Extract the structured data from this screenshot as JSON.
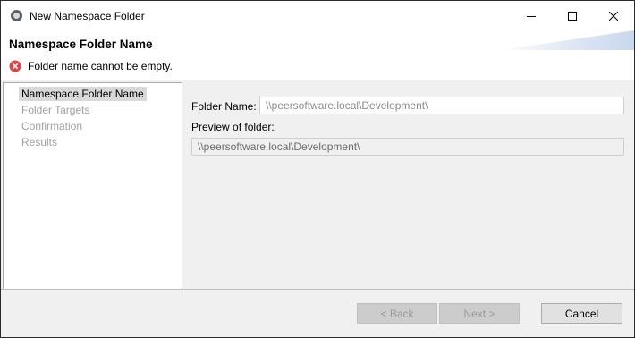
{
  "window": {
    "title": "New Namespace Folder",
    "icon": "app-icon",
    "controls": [
      "minimize-icon",
      "maximize-icon",
      "close-icon"
    ]
  },
  "header": {
    "title": "Namespace Folder Name",
    "error_icon": "error-icon",
    "error_color": "#e04343",
    "error_message": "Folder name cannot be empty."
  },
  "nav": {
    "items": [
      {
        "label": "Namespace Folder Name",
        "active": true
      },
      {
        "label": "Folder Targets",
        "active": false
      },
      {
        "label": "Confirmation",
        "active": false
      },
      {
        "label": "Results",
        "active": false
      }
    ]
  },
  "form": {
    "folder_name_label": "Folder Name:",
    "folder_name_value": "\\\\peersoftware.local\\Development\\",
    "preview_label": "Preview of folder:",
    "preview_value": "\\\\peersoftware.local\\Development\\"
  },
  "footer": {
    "back_label": "< Back",
    "next_label": "Next >",
    "cancel_label": "Cancel"
  }
}
